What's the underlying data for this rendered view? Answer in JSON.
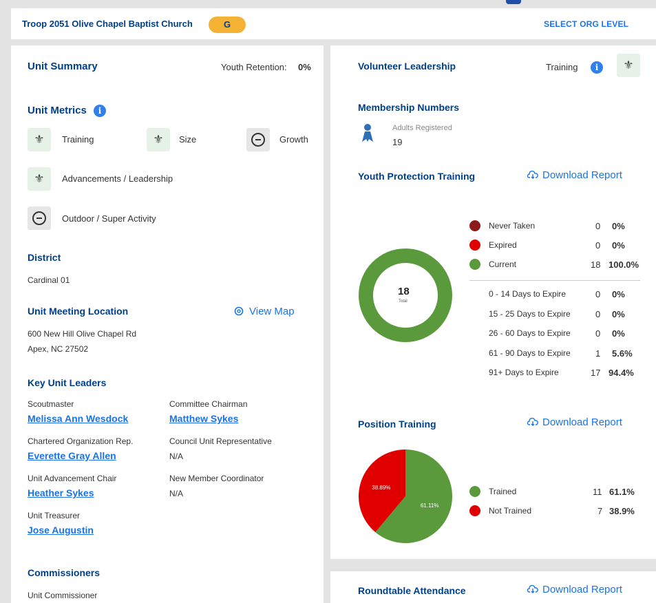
{
  "topbar": {
    "org_name": "Troop 2051 Olive Chapel Baptist Church",
    "badge": "G",
    "select_org_level": "SELECT ORG LEVEL"
  },
  "unit_summary": {
    "title": "Unit Summary",
    "youth_retention_label": "Youth Retention:",
    "youth_retention_value": "0%",
    "metrics_title": "Unit Metrics",
    "metrics": [
      {
        "label": "Training",
        "icon": "fleur-de-lis-icon"
      },
      {
        "label": "Size",
        "icon": "fleur-de-lis-icon"
      },
      {
        "label": "Growth",
        "icon": "minus-circle-icon"
      },
      {
        "label": "Advancements / Leadership",
        "icon": "fleur-de-lis-icon"
      },
      {
        "label": "Outdoor / Super Activity",
        "icon": "minus-circle-icon"
      }
    ],
    "district_title": "District",
    "district": "Cardinal 01",
    "meeting_title": "Unit Meeting Location",
    "view_map": "View Map",
    "address_line1": "600 New Hill Olive Chapel Rd",
    "address_line2": "Apex, NC 27502",
    "leaders_title": "Key Unit Leaders",
    "leaders": [
      {
        "role": "Scoutmaster",
        "name": "Melissa Ann Wesdock"
      },
      {
        "role": "Committee Chairman",
        "name": "Matthew Sykes"
      },
      {
        "role": "Chartered Organization Rep.",
        "name": "Everette Gray Allen"
      },
      {
        "role": "Council Unit Representative",
        "name": "N/A"
      },
      {
        "role": "Unit Advancement Chair",
        "name": "Heather Sykes"
      },
      {
        "role": "New Member Coordinator",
        "name": "N/A"
      },
      {
        "role": "Unit Treasurer",
        "name": "Jose Augustin"
      }
    ],
    "commissioners_title": "Commissioners",
    "commissioner_role": "Unit Commissioner"
  },
  "volunteer": {
    "title": "Volunteer Leadership",
    "training_label": "Training",
    "membership_title": "Membership Numbers",
    "adults_label": "Adults Registered",
    "adults_value": "19",
    "ypt_title": "Youth Protection Training",
    "download": "Download Report",
    "donut_total": "18",
    "donut_total_label": "Total",
    "ypt_legend": [
      {
        "label": "Never Taken",
        "count": "0",
        "pct": "0%",
        "color": "#8b1a1a"
      },
      {
        "label": "Expired",
        "count": "0",
        "pct": "0%",
        "color": "#e00000"
      },
      {
        "label": "Current",
        "count": "18",
        "pct": "100.0%",
        "color": "#5b9a3c"
      }
    ],
    "ypt_expire": [
      {
        "label": "0 - 14 Days to Expire",
        "count": "0",
        "pct": "0%"
      },
      {
        "label": "15 - 25 Days to Expire",
        "count": "0",
        "pct": "0%"
      },
      {
        "label": "26 - 60 Days to Expire",
        "count": "0",
        "pct": "0%"
      },
      {
        "label": "61 - 90 Days to Expire",
        "count": "1",
        "pct": "5.6%"
      },
      {
        "label": "91+ Days to Expire",
        "count": "17",
        "pct": "94.4%"
      }
    ],
    "position_title": "Position Training",
    "pos_legend": [
      {
        "label": "Trained",
        "count": "11",
        "pct": "61.1%",
        "color": "#5b9a3c"
      },
      {
        "label": "Not Trained",
        "count": "7",
        "pct": "38.9%",
        "color": "#e00000"
      }
    ],
    "roundtable_title": "Roundtable Attendance"
  },
  "chart_data": [
    {
      "type": "pie",
      "title": "",
      "categories": [
        "Never Taken",
        "Expired",
        "Current"
      ],
      "values": [
        0,
        0,
        18
      ],
      "colors": [
        "#8b1a1a",
        "#e00000",
        "#5b9a3c"
      ],
      "center_text": "18 Total"
    },
    {
      "type": "pie",
      "title": "",
      "categories": [
        "Trained",
        "Not Trained"
      ],
      "values": [
        61.11,
        38.89
      ],
      "slice_labels": [
        "61.11%",
        "38.89%"
      ],
      "colors": [
        "#5b9a3c",
        "#e00000"
      ]
    }
  ]
}
